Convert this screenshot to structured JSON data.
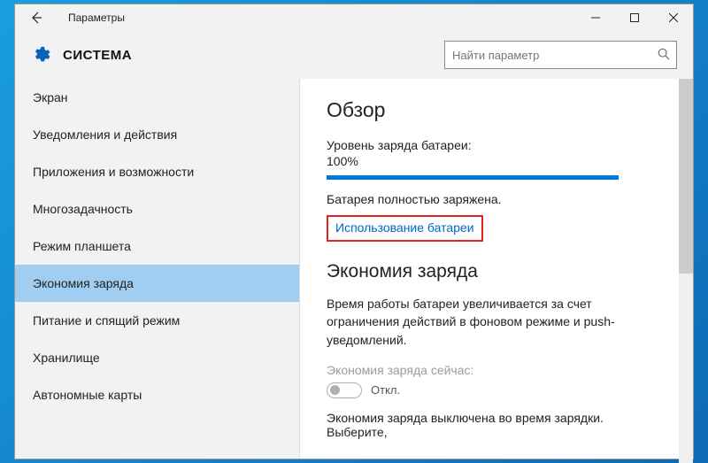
{
  "titlebar": {
    "title": "Параметры"
  },
  "header": {
    "title": "СИСТЕМА"
  },
  "search": {
    "placeholder": "Найти параметр"
  },
  "sidebar": {
    "items": [
      {
        "label": "Экран"
      },
      {
        "label": "Уведомления и действия"
      },
      {
        "label": "Приложения и возможности"
      },
      {
        "label": "Многозадачность"
      },
      {
        "label": "Режим планшета"
      },
      {
        "label": "Экономия заряда"
      },
      {
        "label": "Питание и спящий режим"
      },
      {
        "label": "Хранилище"
      },
      {
        "label": "Автономные карты"
      }
    ],
    "selected_index": 5
  },
  "overview": {
    "heading": "Обзор",
    "level_label": "Уровень заряда батареи:",
    "level_value": "100%",
    "status": "Батарея полностью заряжена.",
    "usage_link": "Использование батареи"
  },
  "saver": {
    "heading": "Экономия заряда",
    "description": "Время работы батареи увеличивается за счет ограничения действий в фоновом режиме и push-уведомлений.",
    "now_label": "Экономия заряда сейчас:",
    "toggle_state": "Откл.",
    "note": "Экономия заряда выключена во время зарядки. Выберите,"
  },
  "colors": {
    "accent": "#0078d7",
    "highlight_border": "#e1251b"
  }
}
